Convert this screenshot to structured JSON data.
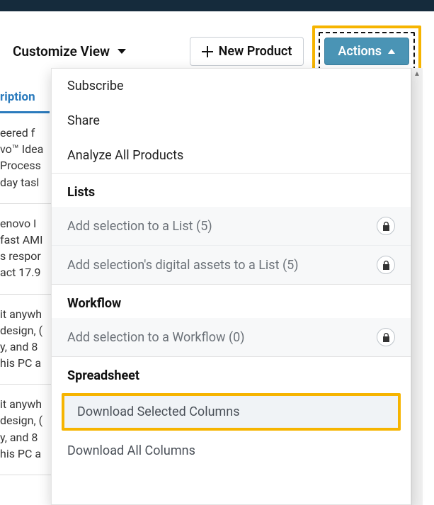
{
  "toolbar": {
    "customize_label": "Customize View",
    "new_product_label": "New Product",
    "actions_label": "Actions"
  },
  "column_header": "ription",
  "rows": [
    "eered f\nvo™ Idea\nProcess\nday tasl",
    "enovo I\nfast AMI\ns respor\nact 17.9",
    "it anywh\ndesign, (\ny, and 8\nhis PC a",
    "it anywh\ndesign, (\ny, and 8\nhis PC a"
  ],
  "menu": {
    "items": [
      {
        "label": "Subscribe"
      },
      {
        "label": "Share"
      },
      {
        "label": "Analyze All Products"
      }
    ],
    "lists_header": "Lists",
    "lists": [
      {
        "label": "Add selection to a List (5)",
        "locked": true
      },
      {
        "label": "Add selection's digital assets to a List (5)",
        "locked": true
      }
    ],
    "workflow_header": "Workflow",
    "workflow": [
      {
        "label": "Add selection to a Workflow (0)",
        "locked": true
      }
    ],
    "spreadsheet_header": "Spreadsheet",
    "spreadsheet": [
      {
        "label": "Download Selected Columns",
        "highlighted": true
      },
      {
        "label": "Download All Columns"
      }
    ]
  }
}
